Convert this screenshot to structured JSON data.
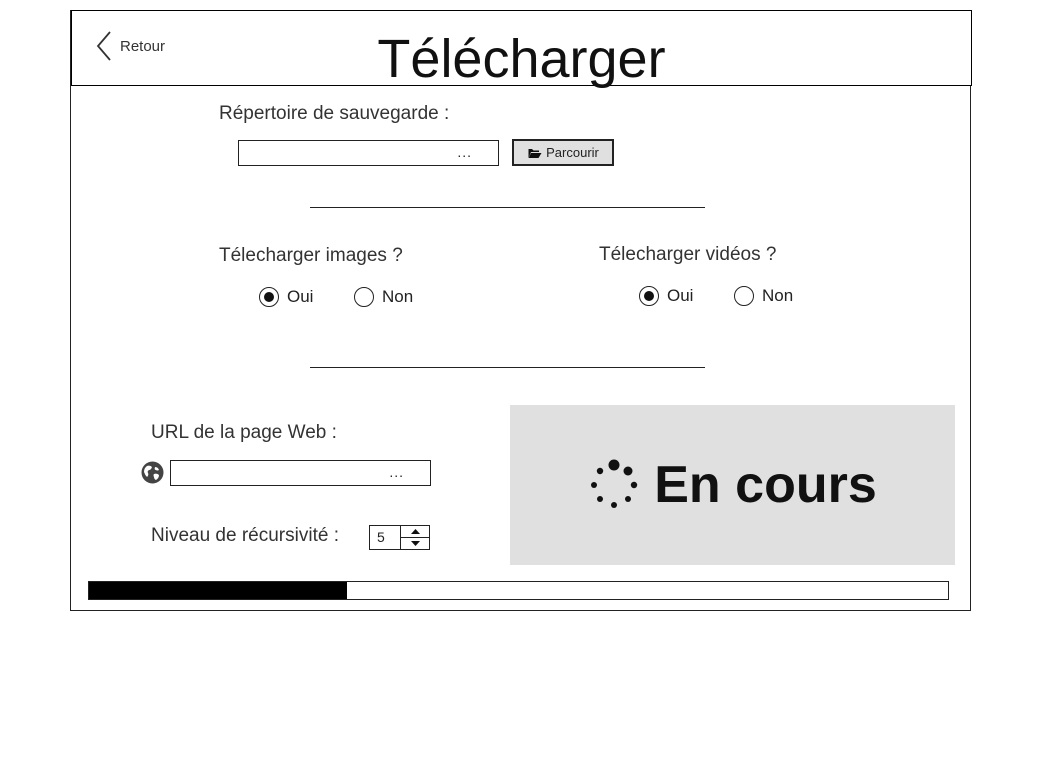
{
  "header": {
    "back_label": "Retour",
    "title": "Télécharger"
  },
  "save_dir": {
    "label": "Répertoire de sauvegarde :",
    "value": "",
    "placeholder": "...",
    "browse_label": "Parcourir"
  },
  "images": {
    "label": "Télecharger images ?",
    "options": [
      "Oui",
      "Non"
    ],
    "selected": "Oui"
  },
  "videos": {
    "label": "Télecharger vidéos ?",
    "options": [
      "Oui",
      "Non"
    ],
    "selected": "Oui"
  },
  "url": {
    "label": "URL de la page Web  :",
    "value": "",
    "placeholder": "..."
  },
  "recursion": {
    "label": "Niveau de récursivité :",
    "value": "5"
  },
  "status": {
    "text": "En cours"
  },
  "progress": {
    "fraction": 0.3
  },
  "colors": {
    "panel_bg": "#e0e0e0",
    "button_bg": "#e0e0e0",
    "progress_fill": "#000000"
  }
}
